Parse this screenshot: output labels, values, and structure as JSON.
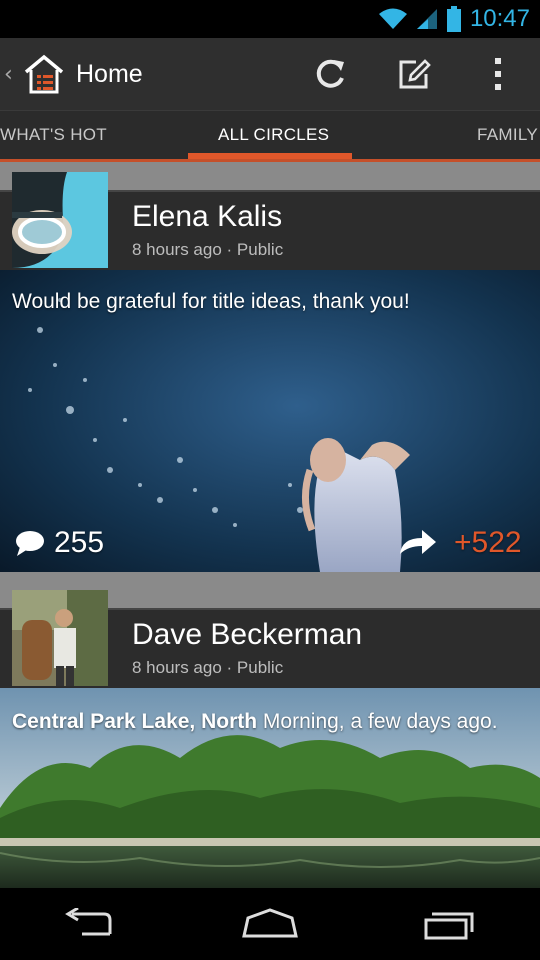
{
  "status_bar": {
    "time": "10:47",
    "icons": [
      "wifi-icon",
      "signal-icon",
      "battery-icon"
    ],
    "accent": "#33b5e5"
  },
  "action_bar": {
    "title": "Home",
    "actions": [
      "refresh-icon",
      "compose-icon",
      "overflow-menu-icon"
    ]
  },
  "tabs": {
    "items": [
      {
        "label": "WHAT'S HOT",
        "active": false
      },
      {
        "label": "ALL CIRCLES",
        "active": true
      },
      {
        "label": "FAMILY",
        "active": false
      }
    ],
    "accent": "#e0572a"
  },
  "posts": [
    {
      "author": "Elena Kalis",
      "meta": "8 hours ago · Public",
      "text": "Would be grateful for title ideas, thank you!",
      "comments": "255",
      "plus_ones": "+522"
    },
    {
      "author": "Dave Beckerman",
      "meta": "8 hours ago · Public",
      "text_bold": "Central Park Lake, North",
      "text_rest": " Morning, a few days ago."
    }
  ],
  "nav_bar": {
    "buttons": [
      "back-icon",
      "home-icon",
      "recent-apps-icon"
    ]
  }
}
